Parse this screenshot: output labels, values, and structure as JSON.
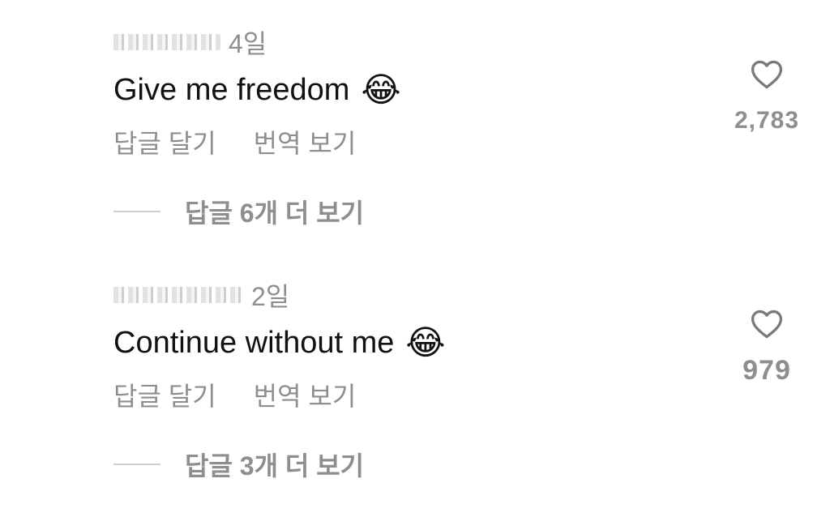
{
  "comments": [
    {
      "time": "4일",
      "text": "Give me freedom",
      "emoji": "😂",
      "actions": {
        "reply": "답글 달기",
        "translate": "번역 보기"
      },
      "more_replies": "답글 6개 더 보기",
      "likes": "2,783"
    },
    {
      "time": "2일",
      "text": "Continue without me",
      "emoji": "😂",
      "actions": {
        "reply": "답글 달기",
        "translate": "번역 보기"
      },
      "more_replies": "답글 3개 더 보기",
      "likes": "979"
    }
  ],
  "icons": {
    "like": "heart-outline-icon"
  },
  "colors": {
    "secondary_text": "#8e8e8e",
    "primary_text": "#111111",
    "divider": "#cfcfcf"
  }
}
